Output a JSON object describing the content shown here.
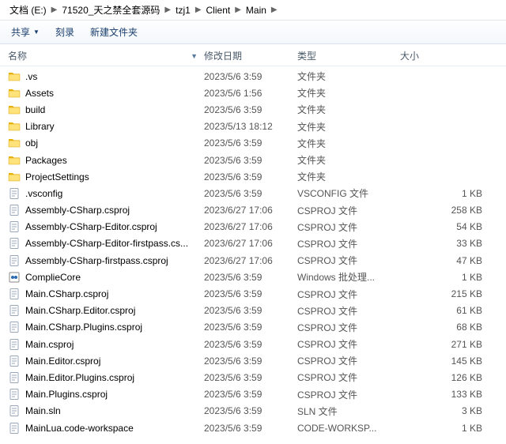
{
  "breadcrumb": [
    "文档 (E:)",
    "71520_天之禁全套源码",
    "tzj1",
    "Client",
    "Main"
  ],
  "toolbar": {
    "share": "共享",
    "burn": "刻录",
    "newfolder": "新建文件夹"
  },
  "columns": {
    "name": "名称",
    "date": "修改日期",
    "type": "类型",
    "size": "大小"
  },
  "rows": [
    {
      "icon": "folder",
      "name": ".vs",
      "date": "2023/5/6 3:59",
      "type": "文件夹",
      "size": ""
    },
    {
      "icon": "folder",
      "name": "Assets",
      "date": "2023/5/6 1:56",
      "type": "文件夹",
      "size": ""
    },
    {
      "icon": "folder",
      "name": "build",
      "date": "2023/5/6 3:59",
      "type": "文件夹",
      "size": ""
    },
    {
      "icon": "folder",
      "name": "Library",
      "date": "2023/5/13 18:12",
      "type": "文件夹",
      "size": ""
    },
    {
      "icon": "folder",
      "name": "obj",
      "date": "2023/5/6 3:59",
      "type": "文件夹",
      "size": ""
    },
    {
      "icon": "folder",
      "name": "Packages",
      "date": "2023/5/6 3:59",
      "type": "文件夹",
      "size": ""
    },
    {
      "icon": "folder",
      "name": "ProjectSettings",
      "date": "2023/5/6 3:59",
      "type": "文件夹",
      "size": ""
    },
    {
      "icon": "file",
      "name": ".vsconfig",
      "date": "2023/5/6 3:59",
      "type": "VSCONFIG 文件",
      "size": "1 KB"
    },
    {
      "icon": "file",
      "name": "Assembly-CSharp.csproj",
      "date": "2023/6/27 17:06",
      "type": "CSPROJ 文件",
      "size": "258 KB"
    },
    {
      "icon": "file",
      "name": "Assembly-CSharp-Editor.csproj",
      "date": "2023/6/27 17:06",
      "type": "CSPROJ 文件",
      "size": "54 KB"
    },
    {
      "icon": "file",
      "name": "Assembly-CSharp-Editor-firstpass.cs...",
      "date": "2023/6/27 17:06",
      "type": "CSPROJ 文件",
      "size": "33 KB"
    },
    {
      "icon": "file",
      "name": "Assembly-CSharp-firstpass.csproj",
      "date": "2023/6/27 17:06",
      "type": "CSPROJ 文件",
      "size": "47 KB"
    },
    {
      "icon": "bat",
      "name": "ComplieCore",
      "date": "2023/5/6 3:59",
      "type": "Windows 批处理...",
      "size": "1 KB"
    },
    {
      "icon": "file",
      "name": "Main.CSharp.csproj",
      "date": "2023/5/6 3:59",
      "type": "CSPROJ 文件",
      "size": "215 KB"
    },
    {
      "icon": "file",
      "name": "Main.CSharp.Editor.csproj",
      "date": "2023/5/6 3:59",
      "type": "CSPROJ 文件",
      "size": "61 KB"
    },
    {
      "icon": "file",
      "name": "Main.CSharp.Plugins.csproj",
      "date": "2023/5/6 3:59",
      "type": "CSPROJ 文件",
      "size": "68 KB"
    },
    {
      "icon": "file",
      "name": "Main.csproj",
      "date": "2023/5/6 3:59",
      "type": "CSPROJ 文件",
      "size": "271 KB"
    },
    {
      "icon": "file",
      "name": "Main.Editor.csproj",
      "date": "2023/5/6 3:59",
      "type": "CSPROJ 文件",
      "size": "145 KB"
    },
    {
      "icon": "file",
      "name": "Main.Editor.Plugins.csproj",
      "date": "2023/5/6 3:59",
      "type": "CSPROJ 文件",
      "size": "126 KB"
    },
    {
      "icon": "file",
      "name": "Main.Plugins.csproj",
      "date": "2023/5/6 3:59",
      "type": "CSPROJ 文件",
      "size": "133 KB"
    },
    {
      "icon": "file",
      "name": "Main.sln",
      "date": "2023/5/6 3:59",
      "type": "SLN 文件",
      "size": "3 KB"
    },
    {
      "icon": "file",
      "name": "MainLua.code-workspace",
      "date": "2023/5/6 3:59",
      "type": "CODE-WORKSP...",
      "size": "1 KB"
    }
  ]
}
